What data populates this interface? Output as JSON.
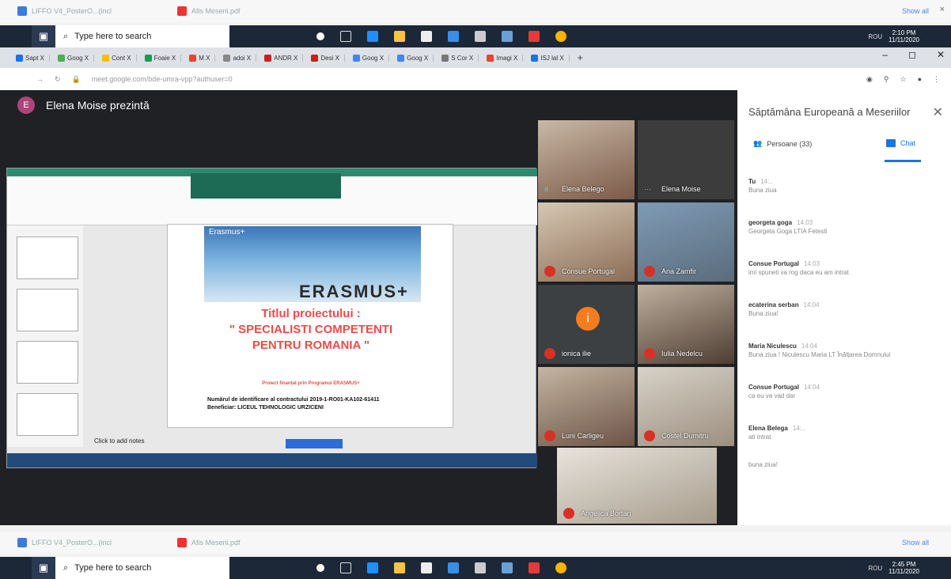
{
  "downloads_top": {
    "file1": "LIFFO V4_PosterO...(incl",
    "file2": "Afis Meserii.pdf",
    "show_all": "Show all",
    "close": "×"
  },
  "taskbar_top": {
    "search_placeholder": "Type here to search",
    "time": "2:10 PM",
    "date": "11/11/2020",
    "lang": "ROU"
  },
  "browser": {
    "tabs": [
      "Sapt X",
      "Goog X",
      "Cont X",
      "Foaie X",
      "M X",
      "adoi X",
      "ANDR X",
      "Desi X",
      "Goog X",
      "Goog X",
      "S Cor X",
      "Imagi X",
      "ISJ lal X"
    ],
    "new_tab": "+",
    "url": "meet.google.com/bde-umra-vpp?authuser=0"
  },
  "meet": {
    "presenter_initial": "E",
    "presenter_text": "Elena Moise prezintă",
    "slide": {
      "erasmus_logo": "Erasmus+",
      "watermark": "ERASMUS+",
      "title_line1": "Titlul proiectului :",
      "title_line2": "\" SPECIALISTI COMPETENTI",
      "title_line3": "PENTRU ROMANIA \"",
      "funded": "Proiect finanțat prin Programul ERASMUS+",
      "contract": "Numărul de identificare al contractului 2019-1-RO01-KA102-61411",
      "beneficiary": "Beneficiar: LICEUL TEHNOLOGIC URZICENI",
      "notes": "Click to add notes"
    },
    "participants": [
      {
        "name": "Elena Belego"
      },
      {
        "name": "Elena Moise"
      },
      {
        "name": "Consue Portugal"
      },
      {
        "name": "Ana Zamfir"
      },
      {
        "name": "ionica ilie",
        "initial": "i"
      },
      {
        "name": "Iulia Nedelcu"
      },
      {
        "name": "Luni Carligeu"
      },
      {
        "name": "Costel Dumitru"
      },
      {
        "name": "Angelica Bortan"
      }
    ]
  },
  "panel": {
    "title": "Săptămâna Europeană a Meseriilor",
    "close": "✕",
    "people_tab": "Persoane (33)",
    "chat_tab": "Chat",
    "messages": [
      {
        "author": "Tu",
        "time": "14:..",
        "text": "Buna ziua"
      },
      {
        "author": "georgeta goga",
        "time": "14:03",
        "text": "Georgeta Goga LTIA Fetesti"
      },
      {
        "author": "Consue Portugal",
        "time": "14:03",
        "text": "imi spuneti va rog daca eu am intrat"
      },
      {
        "author": "ecaterina serban",
        "time": "14:04",
        "text": "Buna ziua!"
      },
      {
        "author": "Maria Niculescu",
        "time": "14:04",
        "text": "Buna ziua ! Niculescu Maria LT Înălțarea Domnului"
      },
      {
        "author": "Consue Portugal",
        "time": "14:04",
        "text": "ca eu va vad dar"
      },
      {
        "author": "Elena Belega",
        "time": "14:..",
        "text": "ati intrat"
      },
      {
        "author": "",
        "time": "",
        "text": "buna ziua!"
      }
    ]
  },
  "downloads_bottom": {
    "file1": "LIFFO V4_PosterO...(incl",
    "file2": "Afis Meserii.pdf",
    "show_all": "Show all"
  },
  "taskbar_bottom": {
    "search_placeholder": "Type here to search",
    "time": "2:45 PM",
    "date": "11/11/2020",
    "lang": "ROU"
  }
}
